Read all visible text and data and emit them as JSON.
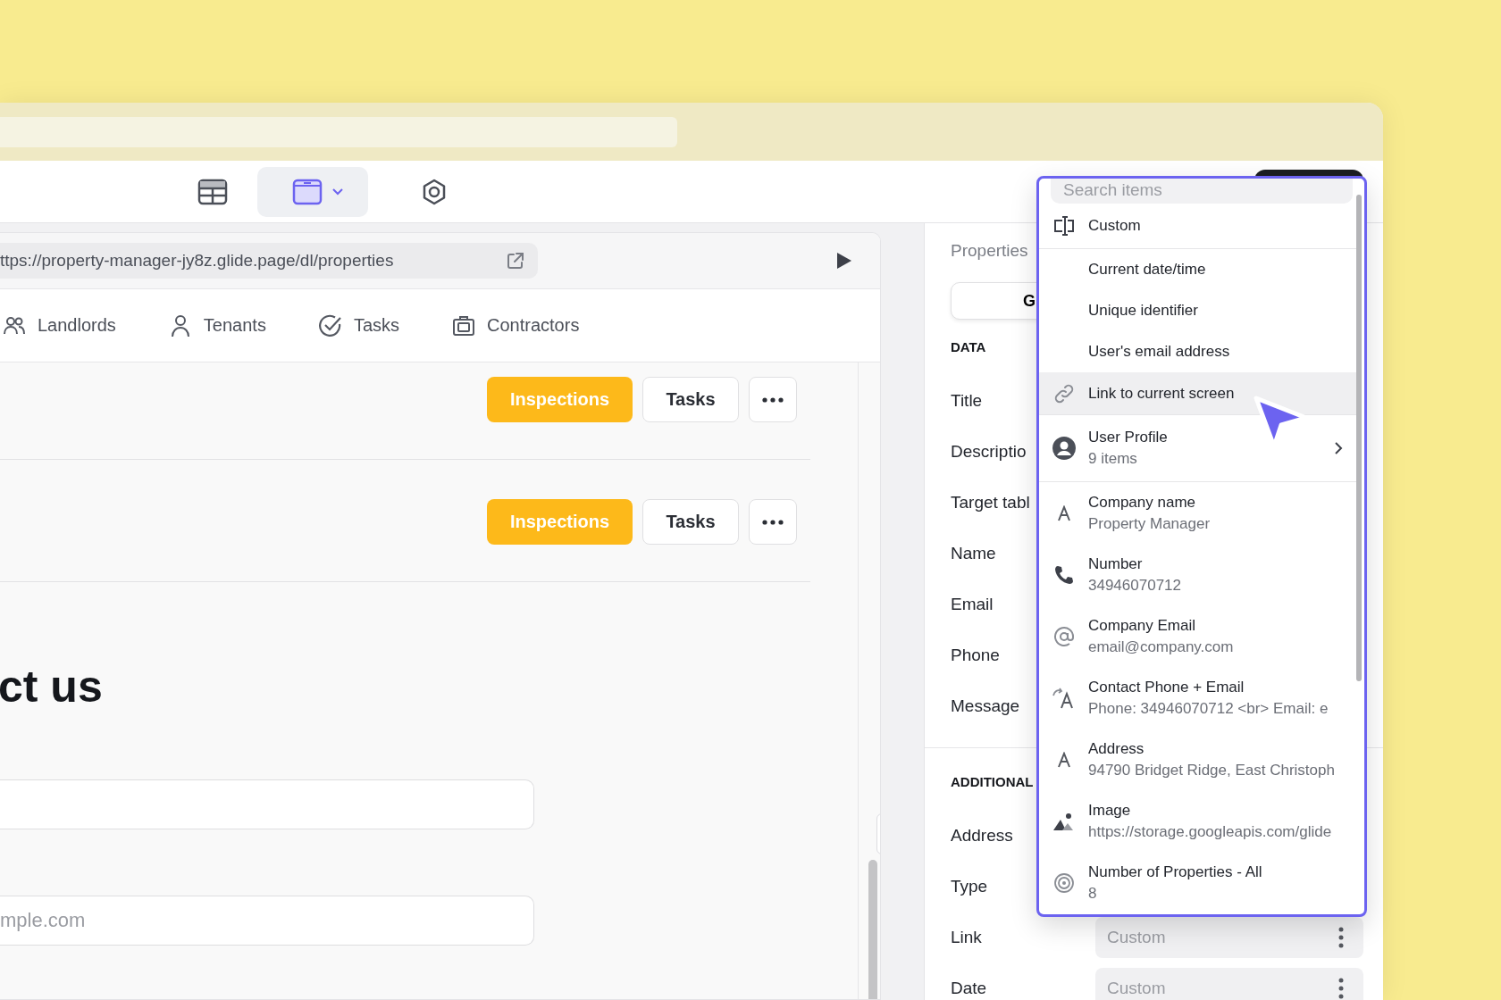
{
  "toolbar": {
    "tabs": [
      {
        "kind": "table",
        "selected": false
      },
      {
        "kind": "screen",
        "selected": true
      },
      {
        "kind": "gear",
        "selected": false
      }
    ]
  },
  "preview": {
    "url": "ttps://property-manager-jy8z.glide.page/dl/properties",
    "nav_tabs": [
      {
        "label": "Landlords",
        "kind": "people"
      },
      {
        "label": "Tenants",
        "kind": "person"
      },
      {
        "label": "Tasks",
        "kind": "check"
      },
      {
        "label": "Contractors",
        "kind": "case"
      }
    ],
    "rows": [
      {
        "buttons": [
          {
            "label": "Inspections",
            "kind": "primary"
          },
          {
            "label": "Tasks",
            "kind": "secondary"
          },
          {
            "kind": "more"
          }
        ]
      },
      {
        "buttons": [
          {
            "label": "Inspections",
            "kind": "primary"
          },
          {
            "label": "Tasks",
            "kind": "secondary"
          },
          {
            "kind": "more"
          }
        ]
      }
    ],
    "heading": "ct us",
    "fields": [
      {
        "kind": "input"
      },
      {
        "kind": "input",
        "placeholder": "mple.com"
      }
    ]
  },
  "properties": {
    "title": "Properties",
    "segment": "G",
    "sections": [
      {
        "heading": "DATA",
        "fields": [
          {
            "label": "Title"
          },
          {
            "label": "Descriptio"
          },
          {
            "label": "Target tabl"
          },
          {
            "label": "Name"
          },
          {
            "label": "Email"
          },
          {
            "label": "Phone"
          },
          {
            "label": "Message"
          }
        ]
      },
      {
        "heading": "ADDITIONAL",
        "fields": [
          {
            "label": "Address"
          },
          {
            "label": "Type"
          },
          {
            "label": "Link",
            "placeholder": "Custom"
          },
          {
            "label": "Date",
            "placeholder": "Custom"
          }
        ]
      }
    ]
  },
  "dropdown": {
    "search_placeholder": "Search items",
    "items": [
      {
        "label": "Custom",
        "kind": "custom",
        "selected": false
      },
      {
        "label": "Current date/time",
        "kind": "plain",
        "selected": false
      },
      {
        "label": "Unique identifier",
        "kind": "plain",
        "selected": false
      },
      {
        "label": "User's email address",
        "kind": "plain",
        "selected": false
      },
      {
        "label": "Link to current screen",
        "kind": "link",
        "selected": true
      },
      {
        "label": "User Profile",
        "sub": "9 items",
        "kind": "profile",
        "selected": false
      },
      {
        "label": "Company name",
        "sub": "Property Manager",
        "kind": "text",
        "selected": false
      },
      {
        "label": "Number",
        "sub": "34946070712",
        "kind": "phone",
        "selected": false
      },
      {
        "label": "Company Email",
        "sub": "email@company.com",
        "kind": "email",
        "selected": false
      },
      {
        "label": "Contact Phone + Email",
        "sub": "Phone: 34946070712 <br> Email: e",
        "kind": "template",
        "selected": false
      },
      {
        "label": "Address",
        "sub": "94790 Bridget Ridge, East Christoph",
        "kind": "text",
        "selected": false
      },
      {
        "label": "Image",
        "sub": "https://storage.googleapis.com/glide",
        "kind": "image",
        "selected": false
      },
      {
        "label": "Number of Properties - All",
        "sub": "8",
        "kind": "rollup",
        "selected": false
      }
    ]
  }
}
